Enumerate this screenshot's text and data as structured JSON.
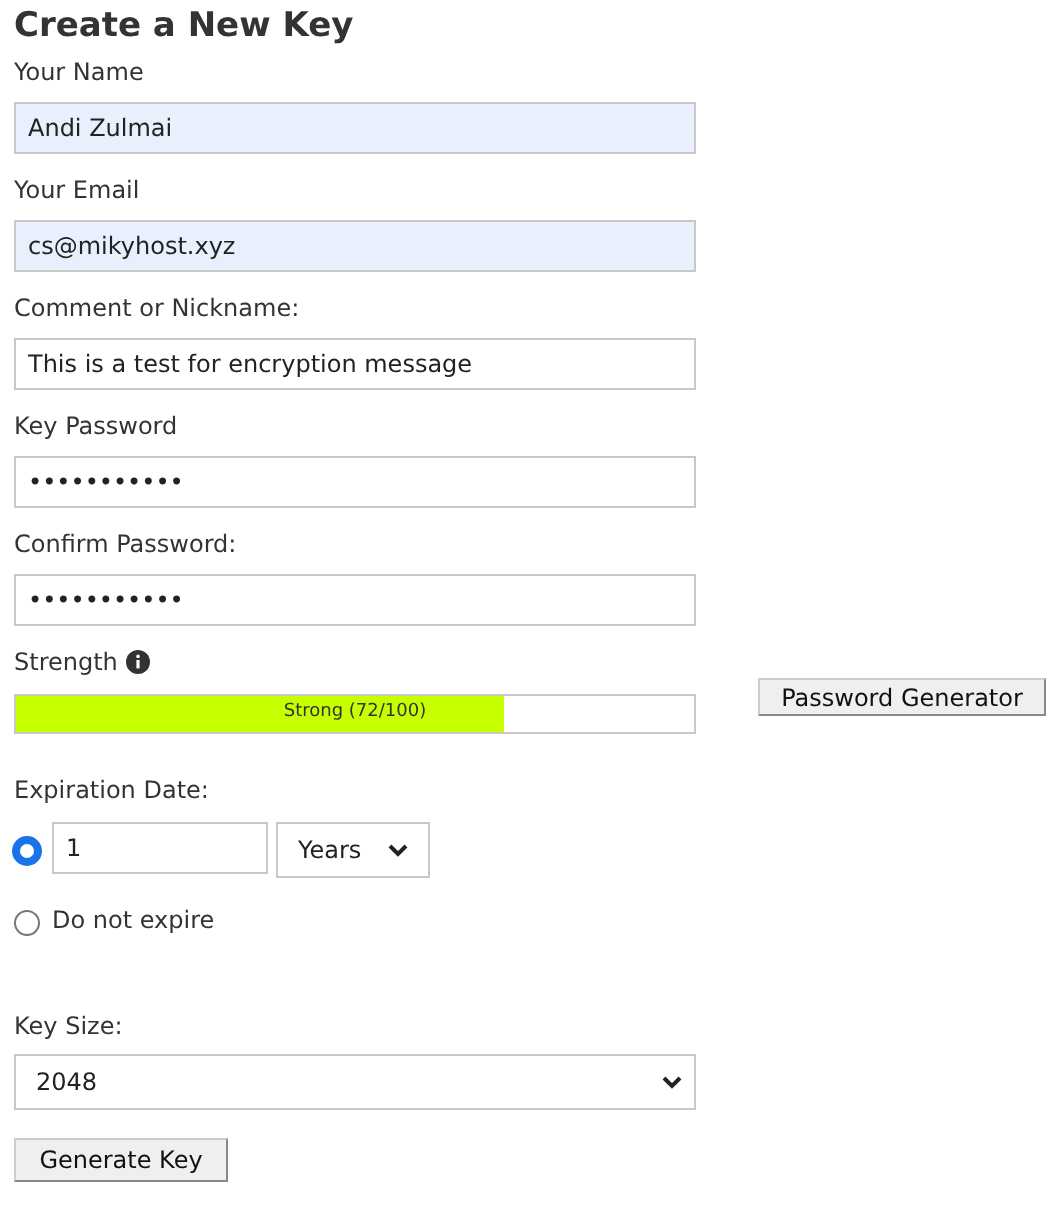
{
  "title": "Create a New Key",
  "fields": [
    {
      "label": "Your Name",
      "value": "Andi Zulmai",
      "autofilled": true
    },
    {
      "label": "Your Email",
      "value": "cs@mikyhost.xyz",
      "autofilled": true
    },
    {
      "label": "Comment or Nickname:",
      "value": "This is a test for encryption message",
      "autofilled": false
    },
    {
      "label": "Key Password",
      "value": "•••••••••••",
      "autofilled": false
    },
    {
      "label": "Confirm Password:",
      "value": "•••••••••••",
      "autofilled": false
    }
  ],
  "strength": {
    "label": "Strength",
    "reading": "Strong (72/100)",
    "level": 0.72,
    "generator_button": "Password Generator"
  },
  "expiration": {
    "label": "Expiration Date:",
    "options": [
      {
        "kind": "duration",
        "selected": true,
        "value": "1",
        "unit": "Years"
      },
      {
        "kind": "text",
        "selected": false,
        "label": "Do not expire"
      }
    ]
  },
  "key_size": {
    "label": "Key Size:",
    "value": "2048"
  },
  "submit_button": "Generate Key"
}
